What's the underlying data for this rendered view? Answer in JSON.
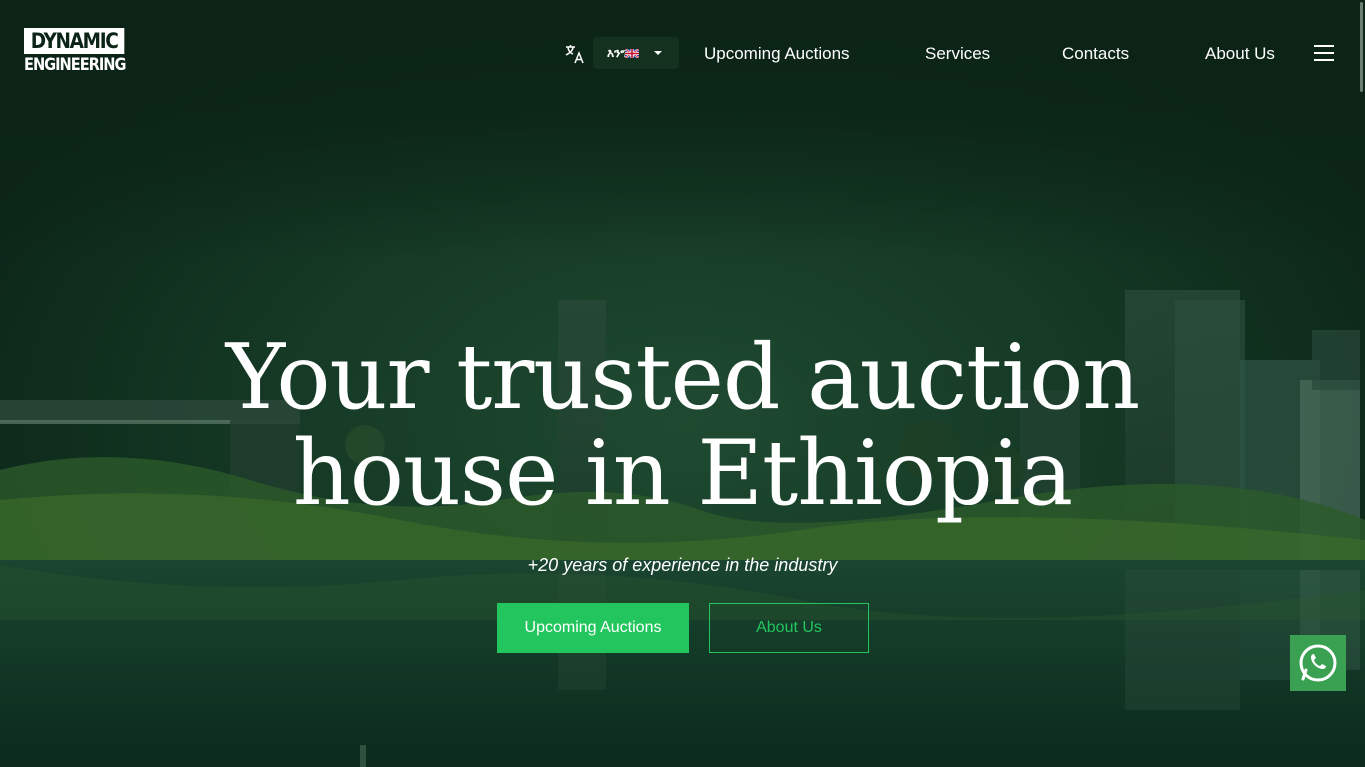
{
  "header": {
    "logo_line1": "DYNAMIC",
    "logo_line2": "ENGINEERING",
    "language": {
      "selected_label": "እንግ"
    },
    "nav": [
      {
        "label": "Upcoming Auctions"
      },
      {
        "label": "Services"
      },
      {
        "label": "Contacts"
      },
      {
        "label": "About Us"
      }
    ],
    "icons": {
      "translate": "translate-icon",
      "menu": "hamburger-menu-icon",
      "dropdown": "chevron-down-icon",
      "flag": "uk-flag-icon"
    }
  },
  "hero": {
    "title_line1": "Your trusted auction",
    "title_line2": "house in Ethiopia",
    "subtitle": "+20 years of experience in the industry",
    "primary_button": "Upcoming Auctions",
    "secondary_button": "About Us"
  },
  "floating": {
    "whatsapp_icon": "whatsapp-icon"
  },
  "colors": {
    "accent": "#22c55e",
    "whatsapp": "#3aa052",
    "background": "#0b2417",
    "text": "#ffffff"
  }
}
